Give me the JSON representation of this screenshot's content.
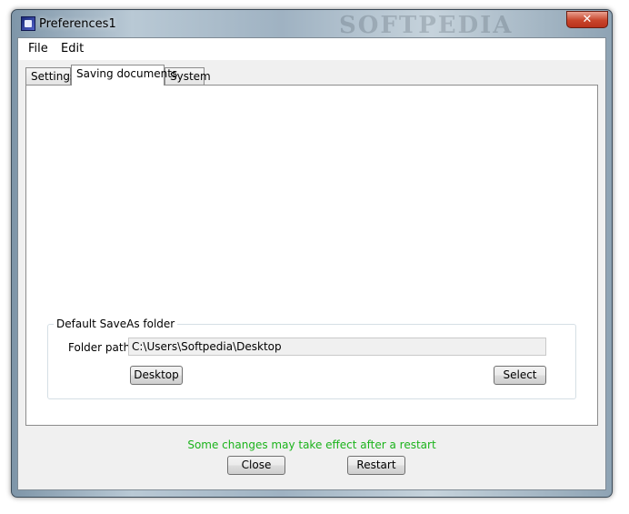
{
  "window": {
    "title": "Preferences1",
    "watermark": "SOFTPEDIA",
    "close_symbol": "✕"
  },
  "menu": {
    "items": [
      "File",
      "Edit"
    ]
  },
  "tabs": [
    {
      "label": "Settings",
      "active": false
    },
    {
      "label": "Saving documents",
      "active": true
    },
    {
      "label": "System",
      "active": false
    }
  ],
  "saveas": {
    "group_title": "Default SaveAs folder",
    "folder_label": "Folder path:",
    "folder_value": "C:\\Users\\Softpedia\\Desktop",
    "desktop_button": "Desktop",
    "select_button": "Select"
  },
  "footer": {
    "status": "Some changes may take effect after a restart",
    "status_color": "#1bb31b",
    "close_button": "Close",
    "restart_button": "Restart"
  }
}
